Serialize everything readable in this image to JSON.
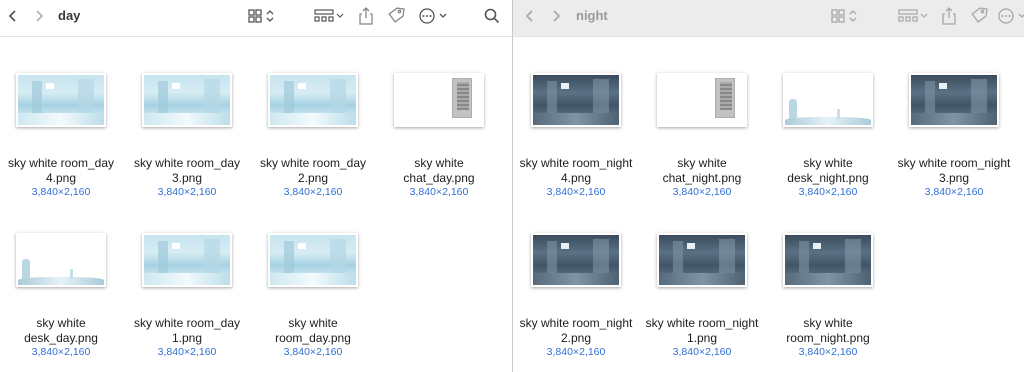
{
  "colors": {
    "accent": "#2f6fd6",
    "divider": "#c8c8c8"
  },
  "windows": [
    {
      "title": "day",
      "toolbar_icons": [
        "back-chevron-icon",
        "forward-chevron-icon",
        "grid-view-icon",
        "group-by-icon",
        "share-icon",
        "tag-icon",
        "more-icon",
        "search-icon"
      ],
      "files": [
        {
          "name": "sky white room_day\n4.png",
          "dims": "3,840×2,160",
          "thumb": "day-room"
        },
        {
          "name": "sky white room_day\n3.png",
          "dims": "3,840×2,160",
          "thumb": "day-room"
        },
        {
          "name": "sky white room_day\n2.png",
          "dims": "3,840×2,160",
          "thumb": "day-room"
        },
        {
          "name": "sky white\nchat_day.png",
          "dims": "3,840×2,160",
          "thumb": "chat"
        },
        {
          "name": "sky white\ndesk_day.png",
          "dims": "3,840×2,160",
          "thumb": "desk"
        },
        {
          "name": "sky white room_day\n1.png",
          "dims": "3,840×2,160",
          "thumb": "day-room"
        },
        {
          "name": "sky white\nroom_day.png",
          "dims": "3,840×2,160",
          "thumb": "day-room"
        }
      ]
    },
    {
      "title": "night",
      "toolbar_icons": [
        "back-chevron-icon",
        "forward-chevron-icon",
        "grid-view-icon",
        "group-by-icon",
        "share-icon",
        "tag-icon",
        "more-icon"
      ],
      "files": [
        {
          "name": "sky white room_night\n4.png",
          "dims": "3,840×2,160",
          "thumb": "night-room"
        },
        {
          "name": "sky white\nchat_night.png",
          "dims": "3,840×2,160",
          "thumb": "chat"
        },
        {
          "name": "sky white\ndesk_night.png",
          "dims": "3,840×2,160",
          "thumb": "desk"
        },
        {
          "name": "sky white room_night\n3.png",
          "dims": "3,840×2,160",
          "thumb": "night-room"
        },
        {
          "name": "sky white room_night\n2.png",
          "dims": "3,840×2,160",
          "thumb": "night-room"
        },
        {
          "name": "sky white room_night\n1.png",
          "dims": "3,840×2,160",
          "thumb": "night-room"
        },
        {
          "name": "sky white\nroom_night.png",
          "dims": "3,840×2,160",
          "thumb": "night-room"
        }
      ]
    }
  ]
}
